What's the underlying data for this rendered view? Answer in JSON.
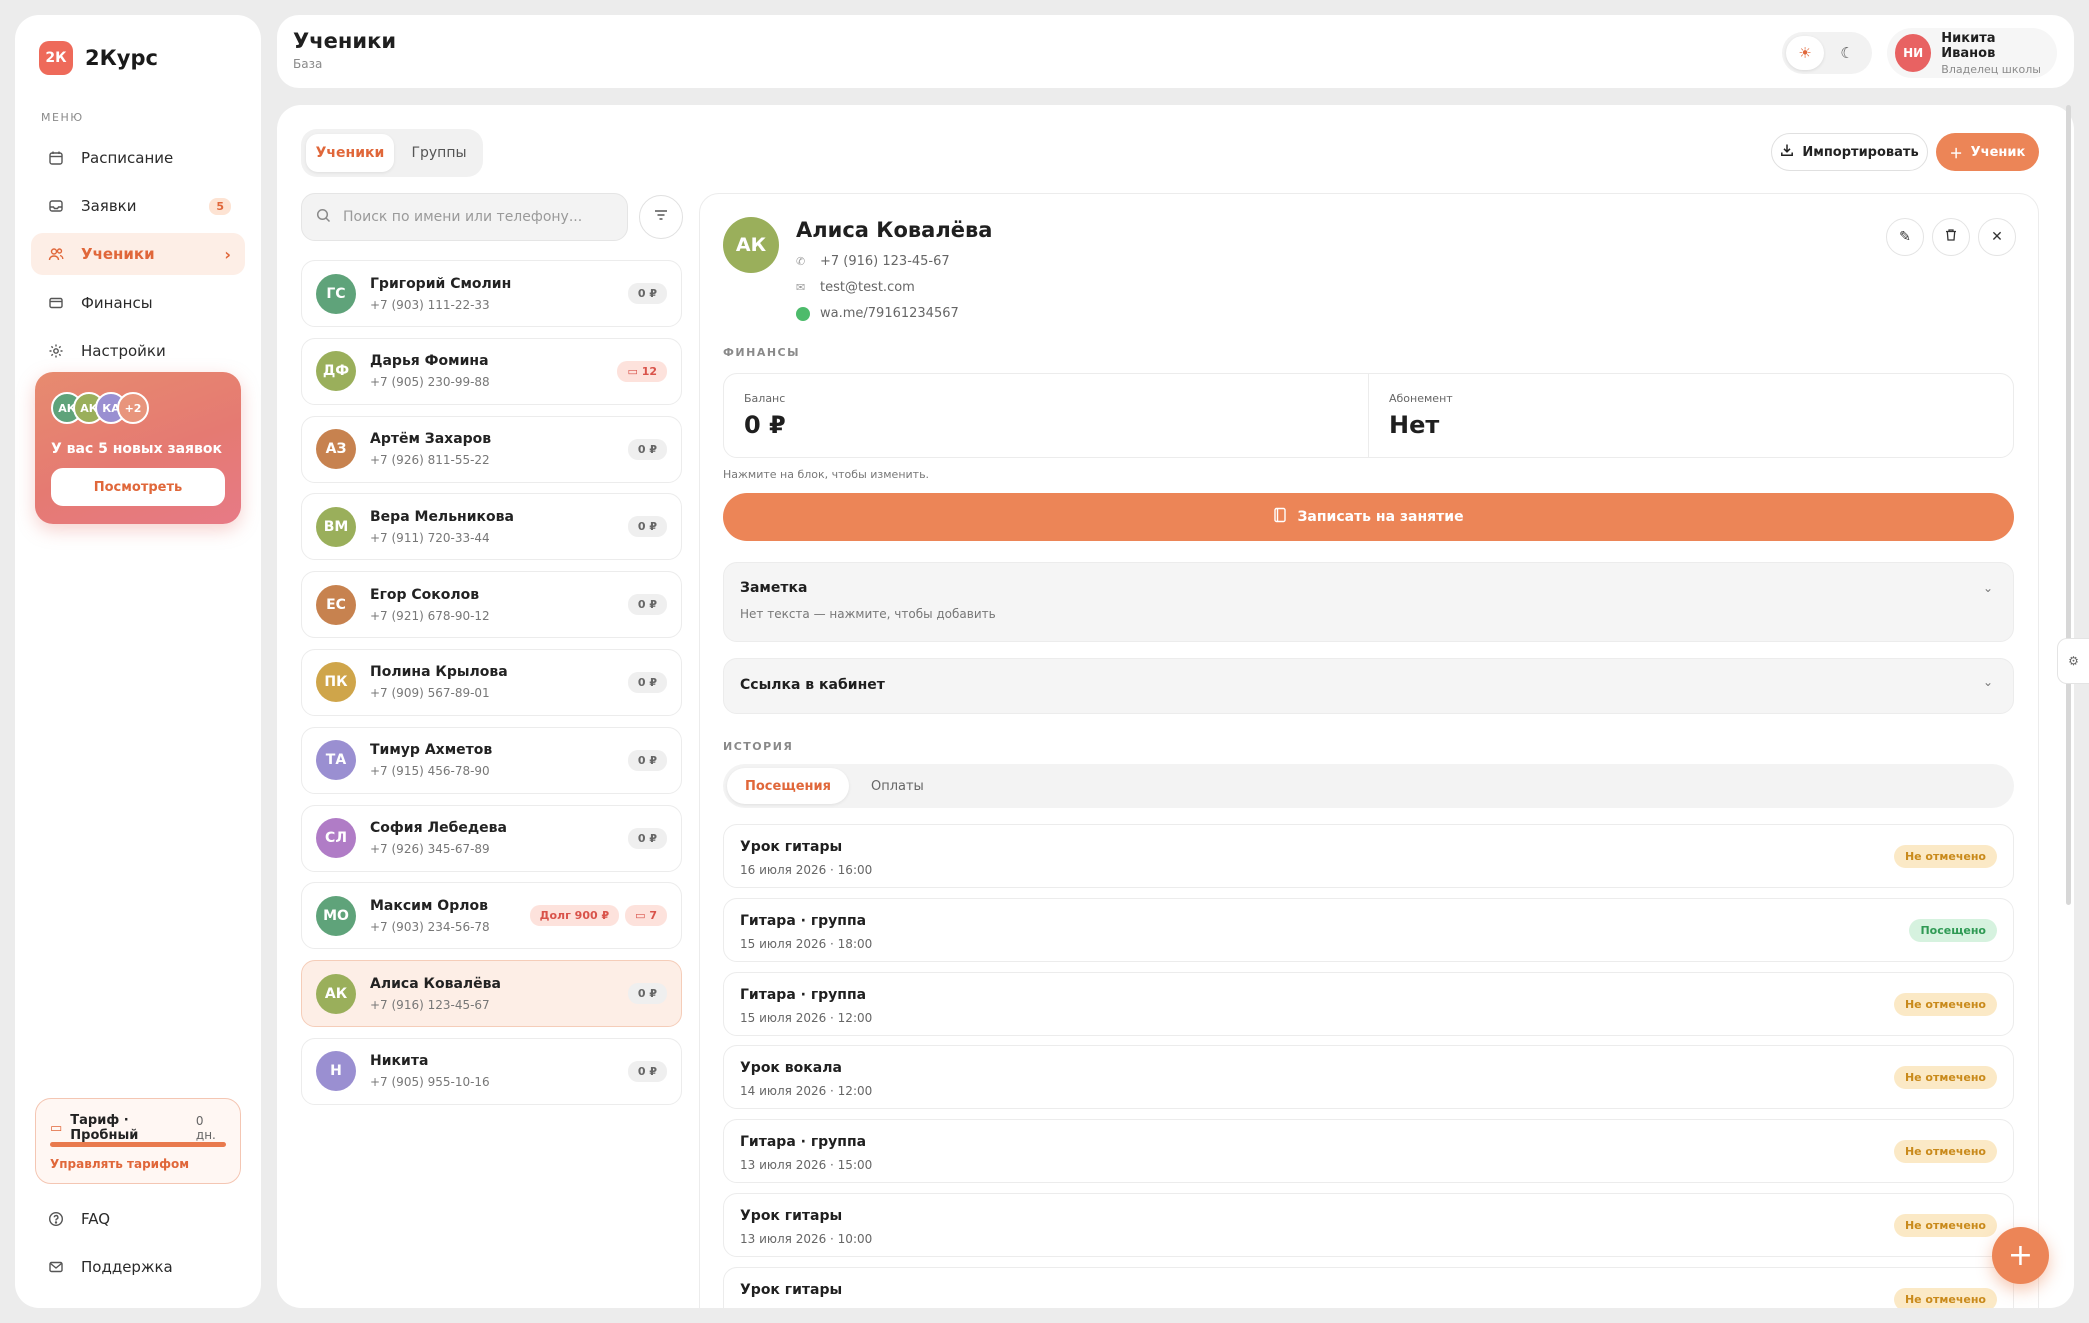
{
  "app": {
    "logo_mark": "2К",
    "logo_name": "2Курс"
  },
  "sidebar": {
    "menu_title": "МЕНЮ",
    "items": [
      {
        "label": "Расписание",
        "icon": "calendar-icon"
      },
      {
        "label": "Заявки",
        "icon": "inbox-icon",
        "badge": "5"
      },
      {
        "label": "Ученики",
        "icon": "users-icon",
        "active": true
      },
      {
        "label": "Финансы",
        "icon": "wallet-icon"
      },
      {
        "label": "Настройки",
        "icon": "gear-icon"
      }
    ],
    "promo": {
      "avatars": [
        "АК",
        "АК",
        "КА",
        "+2"
      ],
      "text": "У вас 5 новых заявок",
      "button": "Посмотреть"
    },
    "tariff": {
      "title": "Тариф · Пробный",
      "days": "0 дн.",
      "progress": 1.0,
      "link": "Управлять тарифом"
    },
    "bottom": [
      {
        "label": "FAQ",
        "icon": "help-icon"
      },
      {
        "label": "Поддержка",
        "icon": "mail-icon"
      }
    ]
  },
  "header": {
    "title": "Ученики",
    "subtitle": "База",
    "user": {
      "initials": "НИ",
      "name": "Никита Иванов",
      "role": "Владелец школы"
    }
  },
  "main": {
    "tabs": [
      "Ученики",
      "Группы"
    ],
    "import_label": "Импортировать",
    "add_label": "Ученик",
    "search_placeholder": "Поиск по имени или телефону...",
    "students": [
      {
        "initials": "ГС",
        "name": "Григорий Смолин",
        "phone": "+7 (903) 111-22-33",
        "color": "#5fa37a",
        "balance": "0 ₽"
      },
      {
        "initials": "ДФ",
        "name": "Дарья Фомина",
        "phone": "+7 (905) 230-99-88",
        "color": "#9aaf5b",
        "count": "12"
      },
      {
        "initials": "АЗ",
        "name": "Артём Захаров",
        "phone": "+7 (926) 811-55-22",
        "color": "#c7824f",
        "balance": "0 ₽"
      },
      {
        "initials": "ВМ",
        "name": "Вера Мельникова",
        "phone": "+7 (911) 720-33-44",
        "color": "#9aaf5b",
        "balance": "0 ₽"
      },
      {
        "initials": "ЕС",
        "name": "Егор Соколов",
        "phone": "+7 (921) 678-90-12",
        "color": "#c7824f",
        "balance": "0 ₽"
      },
      {
        "initials": "ПК",
        "name": "Полина Крылова",
        "phone": "+7 (909) 567-89-01",
        "color": "#cfa54a",
        "balance": "0 ₽"
      },
      {
        "initials": "ТА",
        "name": "Тимур Ахметов",
        "phone": "+7 (915) 456-78-90",
        "color": "#9a8fd1",
        "balance": "0 ₽"
      },
      {
        "initials": "СЛ",
        "name": "София Лебедева",
        "phone": "+7 (926) 345-67-89",
        "color": "#b07cc6",
        "balance": "0 ₽"
      },
      {
        "initials": "МО",
        "name": "Максим Орлов",
        "phone": "+7 (903) 234-56-78",
        "color": "#5fa37a",
        "debt": "Долг 900 ₽",
        "count": "7"
      },
      {
        "initials": "АК",
        "name": "Алиса Ковалёва",
        "phone": "+7 (916) 123-45-67",
        "color": "#9aaf5b",
        "balance": "0 ₽",
        "active": true
      },
      {
        "initials": "Н",
        "name": "Никита",
        "phone": "+7 (905) 955-10-16",
        "color": "#9a8fd1",
        "balance": "0 ₽"
      }
    ]
  },
  "detail": {
    "initials": "АК",
    "name": "Алиса Ковалёва",
    "phone": "+7 (916) 123-45-67",
    "email": "test@test.com",
    "whatsapp": "wa.me/79161234567",
    "finance_title": "ФИНАНСЫ",
    "balance_label": "Баланс",
    "balance_value": "0 ₽",
    "subscription_label": "Абонемент",
    "subscription_value": "Нет",
    "hint": "Нажмите на блок, чтобы изменить.",
    "book_button": "Записать на занятие",
    "note_title": "Заметка",
    "note_text": "Нет текста — нажмите, чтобы добавить",
    "cabinet_title": "Ссылка в кабинет",
    "history_title": "ИСТОРИЯ",
    "history_tabs": [
      "Посещения",
      "Оплаты"
    ],
    "visits": [
      {
        "title": "Урок гитары",
        "date": "16 июля 2026 · 16:00",
        "status": "Не отмечено",
        "attended": false
      },
      {
        "title": "Гитара · группа",
        "date": "15 июля 2026 · 18:00",
        "status": "Посещено",
        "attended": true
      },
      {
        "title": "Гитара · группа",
        "date": "15 июля 2026 · 12:00",
        "status": "Не отмечено",
        "attended": false
      },
      {
        "title": "Урок вокала",
        "date": "14 июля 2026 · 12:00",
        "status": "Не отмечено",
        "attended": false
      },
      {
        "title": "Гитара · группа",
        "date": "13 июля 2026 · 15:00",
        "status": "Не отмечено",
        "attended": false
      },
      {
        "title": "Урок гитары",
        "date": "13 июля 2026 · 10:00",
        "status": "Не отмечено",
        "attended": false
      },
      {
        "title": "Урок гитары",
        "date": "",
        "status": "Не отмечено",
        "attended": false
      }
    ]
  },
  "colors": {
    "accent": "#ec8557",
    "accent_text": "#e0673a",
    "active_bg": "#fdeee6"
  }
}
